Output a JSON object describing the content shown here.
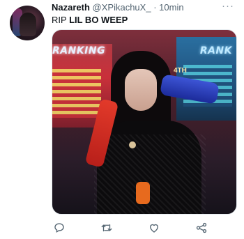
{
  "tweet": {
    "author_name": "Nazareth",
    "author_handle": "@XPikachuX_",
    "separator": "·",
    "time": "10min",
    "text_prefix": "RIP",
    "text_bold": "LIL BO WEEP",
    "more_glyph": "···"
  },
  "media": {
    "sign_left_text": "RANKING",
    "sign_right_text": "RANK",
    "badge_text": "4TH"
  },
  "icons": {
    "reply": "reply-icon",
    "retweet": "retweet-icon",
    "like": "like-icon",
    "share": "share-icon",
    "color": "#536471"
  }
}
